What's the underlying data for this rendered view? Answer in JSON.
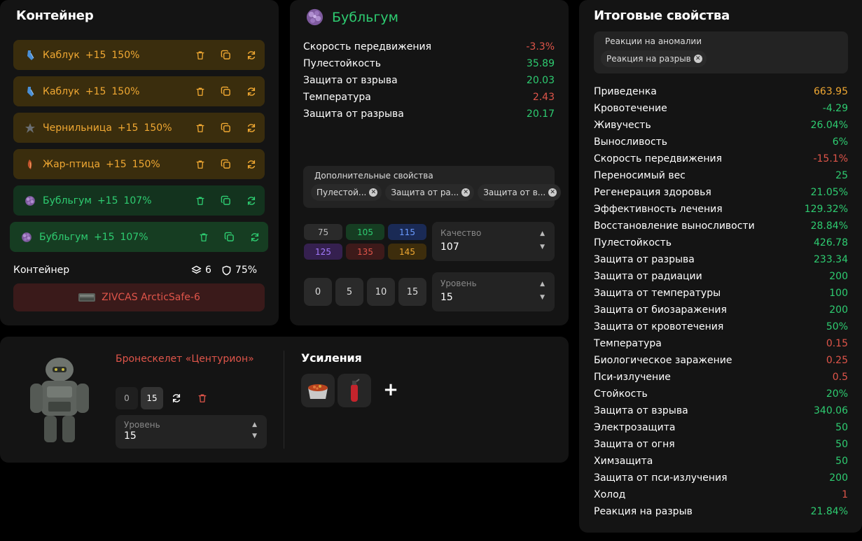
{
  "container_panel": {
    "title": "Контейнер",
    "items": [
      {
        "name": "Каблук",
        "level": "+15",
        "percent": "150%",
        "style": "orange",
        "icon": "bottle-icon"
      },
      {
        "name": "Каблук",
        "level": "+15",
        "percent": "150%",
        "style": "orange",
        "icon": "bottle-icon"
      },
      {
        "name": "Чернильница",
        "level": "+15",
        "percent": "150%",
        "style": "orange",
        "icon": "inkwell-icon"
      },
      {
        "name": "Жар-птица",
        "level": "+15",
        "percent": "150%",
        "style": "orange",
        "icon": "firebird-icon"
      },
      {
        "name": "Бубльгум",
        "level": "+15",
        "percent": "107%",
        "style": "green",
        "icon": "bubblegum-icon"
      },
      {
        "name": "Бубльгум",
        "level": "+15",
        "percent": "107%",
        "style": "green",
        "icon": "bubblegum-icon"
      }
    ],
    "footer_label": "Контейнер",
    "slots_count": "6",
    "protection": "75%",
    "container_name": "ZIVCAS ArcticSafe-6"
  },
  "artifact_panel": {
    "name": "Бубльгум",
    "stats": [
      {
        "label": "Скорость передвижения",
        "value": "-3.3%",
        "tone": "neg"
      },
      {
        "label": "Пулестойкость",
        "value": "35.89",
        "tone": "pos"
      },
      {
        "label": "Защита от взрыва",
        "value": "20.03",
        "tone": "pos"
      },
      {
        "label": "Температура",
        "value": "2.43",
        "tone": "neg"
      },
      {
        "label": "Защита от разрыва",
        "value": "20.17",
        "tone": "pos"
      }
    ],
    "extra_title": "Дополнительные свойства",
    "extra_chips": [
      "Пулестой...",
      "Защита от ра...",
      "Защита от в..."
    ],
    "quality_buttons": [
      {
        "label": "75",
        "bg": "#2a2a2a",
        "fg": "#bbbbbb"
      },
      {
        "label": "105",
        "bg": "#163d22",
        "fg": "#2ecc71"
      },
      {
        "label": "115",
        "bg": "#1a2a55",
        "fg": "#6b9bff"
      },
      {
        "label": "125",
        "bg": "#35204f",
        "fg": "#a57bff"
      },
      {
        "label": "135",
        "bg": "#3d1a1a",
        "fg": "#e0554a"
      },
      {
        "label": "145",
        "bg": "#3d2d0c",
        "fg": "#f0a832"
      }
    ],
    "quality_label": "Качество",
    "quality_value": "107",
    "level_buttons": [
      "0",
      "5",
      "10",
      "15"
    ],
    "level_label": "Уровень",
    "level_value": "15"
  },
  "armor_panel": {
    "name": "Бронескелет «Центурион»",
    "levels": [
      "0",
      "15"
    ],
    "level_label": "Уровень",
    "level_value": "15",
    "boosts_title": "Усиления",
    "add_label": "+"
  },
  "summary_panel": {
    "title": "Итоговые свойства",
    "anomaly_title": "Реакции на аномалии",
    "anomaly_chip": "Реакция на разрыв",
    "stats": [
      {
        "label": "Приведенка",
        "value": "663.95",
        "tone": "gold"
      },
      {
        "label": "Кровотечение",
        "value": "-4.29",
        "tone": "pos"
      },
      {
        "label": "Живучесть",
        "value": "26.04%",
        "tone": "pos"
      },
      {
        "label": "Выносливость",
        "value": "6%",
        "tone": "pos"
      },
      {
        "label": "Скорость передвижения",
        "value": "-15.1%",
        "tone": "neg"
      },
      {
        "label": "Переносимый вес",
        "value": "25",
        "tone": "pos"
      },
      {
        "label": "Регенерация здоровья",
        "value": "21.05%",
        "tone": "pos"
      },
      {
        "label": "Эффективность лечения",
        "value": "129.32%",
        "tone": "pos"
      },
      {
        "label": "Восстановление выносливости",
        "value": "28.84%",
        "tone": "pos"
      },
      {
        "label": "Пулестойкость",
        "value": "426.78",
        "tone": "pos"
      },
      {
        "label": "Защита от разрыва",
        "value": "233.34",
        "tone": "pos"
      },
      {
        "label": "Защита от радиации",
        "value": "200",
        "tone": "pos"
      },
      {
        "label": "Защита от температуры",
        "value": "100",
        "tone": "pos"
      },
      {
        "label": "Защита от биозаражения",
        "value": "200",
        "tone": "pos"
      },
      {
        "label": "Защита от кровотечения",
        "value": "50%",
        "tone": "pos"
      },
      {
        "label": "Температура",
        "value": "0.15",
        "tone": "neg"
      },
      {
        "label": "Биологическое заражение",
        "value": "0.25",
        "tone": "neg"
      },
      {
        "label": "Пси-излучение",
        "value": "0.5",
        "tone": "neg"
      },
      {
        "label": "Стойкость",
        "value": "20%",
        "tone": "pos"
      },
      {
        "label": "Защита от взрыва",
        "value": "340.06",
        "tone": "pos"
      },
      {
        "label": "Электрозащита",
        "value": "50",
        "tone": "pos"
      },
      {
        "label": "Защита от огня",
        "value": "50",
        "tone": "pos"
      },
      {
        "label": "Химзащита",
        "value": "50",
        "tone": "pos"
      },
      {
        "label": "Защита от пси-излучения",
        "value": "200",
        "tone": "pos"
      },
      {
        "label": "Холод",
        "value": "1",
        "tone": "neg"
      },
      {
        "label": "Реакция на разрыв",
        "value": "21.84%",
        "tone": "pos"
      }
    ]
  }
}
